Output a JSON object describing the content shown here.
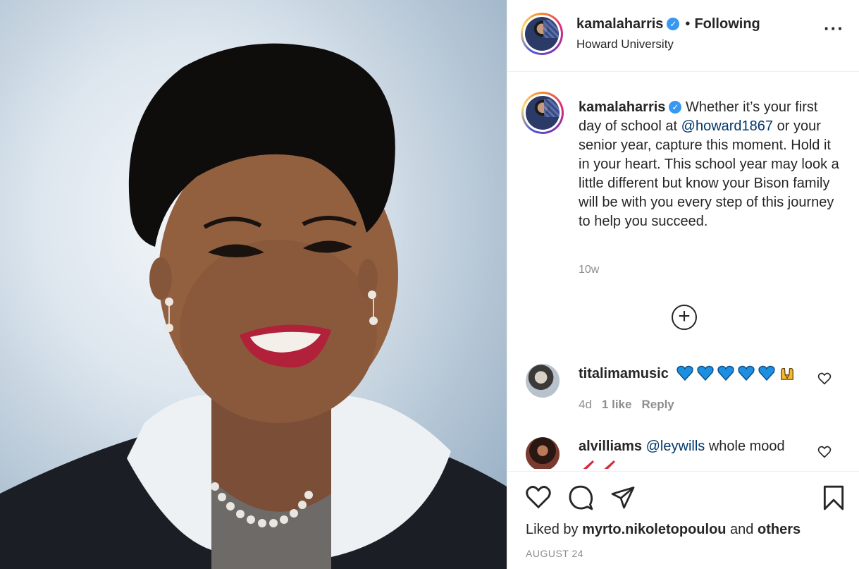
{
  "photo": {
    "alt": "Portrait photo"
  },
  "header": {
    "username": "kamalaharris",
    "separator": "•",
    "follow_state": "Following",
    "location": "Howard University",
    "more_icon": "more-horizontal-icon"
  },
  "caption": {
    "username": "kamalaharris",
    "text_before": "Whether it’s your first day of school at ",
    "mention": "@howard1867",
    "text_after": " or your senior year, capture this moment. Hold it in your heart. This school year may look a little different but know your Bison family will be with you every step of this journey to help you succeed.",
    "time": "10w"
  },
  "load_more_icon": "plus-circle-icon",
  "comments": [
    {
      "username": "titalimamusic",
      "emojis": [
        "blue-heart",
        "blue-heart",
        "blue-heart",
        "blue-heart",
        "blue-heart",
        "raising-hands"
      ],
      "time": "4d",
      "likes": "1 like",
      "reply": "Reply"
    },
    {
      "username": "alvilliams",
      "mention": "@leywills",
      "text": " whole mood",
      "emojis": [
        "high-heel",
        "high-heel"
      ]
    }
  ],
  "footer": {
    "liked_prefix": "Liked by ",
    "liked_user": "myrto.nikoletopoulou",
    "liked_middle": " and ",
    "liked_others": "others",
    "date": "AUGUST 24"
  },
  "colors": {
    "verified": "#3897f0",
    "mention": "#00376b",
    "muted": "#8e8e8e",
    "blue_heart": "#1d8fe1"
  }
}
